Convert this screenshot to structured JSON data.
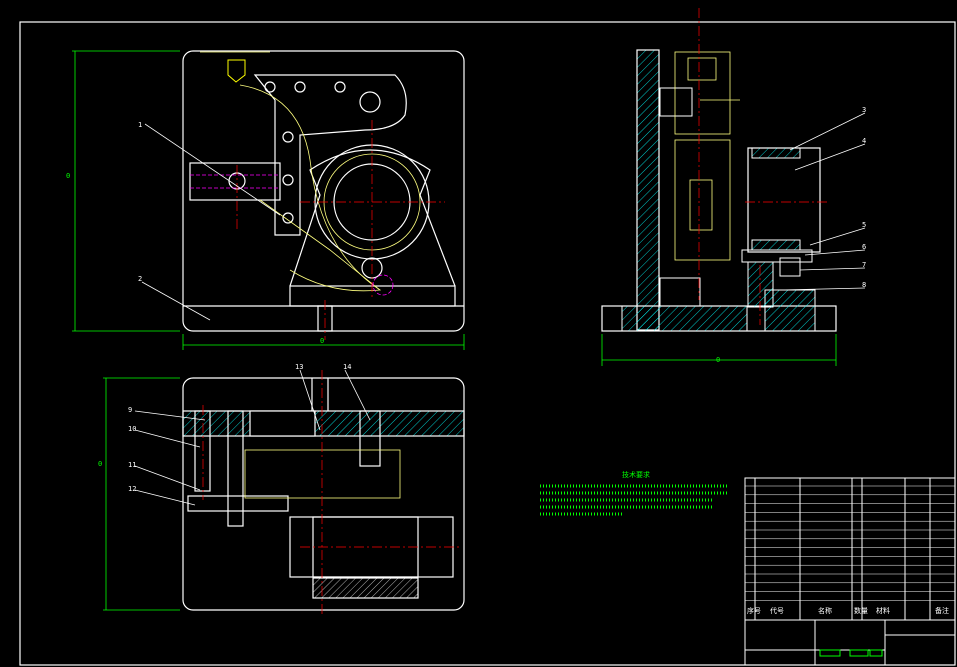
{
  "colors": {
    "background": "#000000",
    "outline": "#ffffff",
    "dimension": "#00ff00",
    "centerline": "#ff0000",
    "secondary": "#ffff80",
    "hatch": "#00ffff",
    "accent": "#ff00ff",
    "dashed": "#ffff00"
  },
  "balloons": {
    "front_view": [
      "1",
      "2"
    ],
    "side_view": [
      "3",
      "4",
      "5",
      "6",
      "7",
      "8"
    ],
    "top_view": [
      "9",
      "10",
      "11",
      "12",
      "13",
      "14"
    ]
  },
  "dimensions": {
    "front_height": "0",
    "front_width": "0",
    "side_width": "0",
    "top_height": "0"
  },
  "notes": {
    "tech_requirements_title": "技术要求"
  },
  "title_block": {
    "header_labels": [
      "序号",
      "代号",
      "名称",
      "数量",
      "材料",
      "备注"
    ]
  }
}
